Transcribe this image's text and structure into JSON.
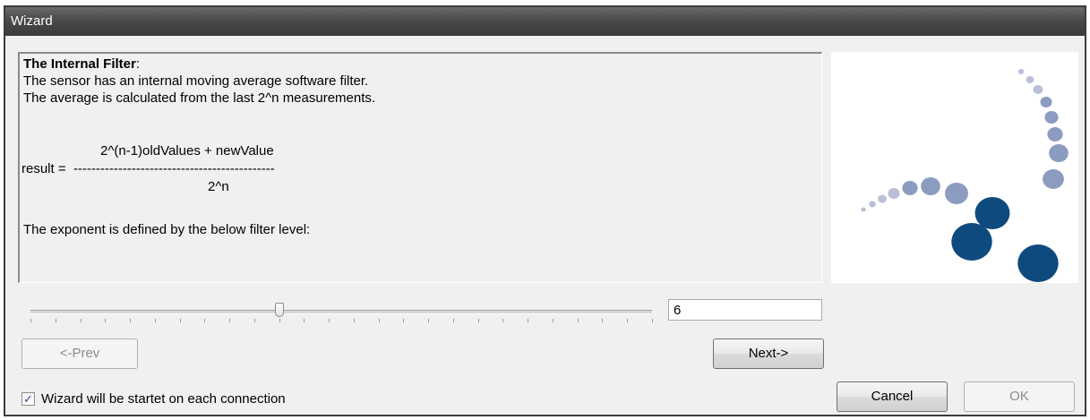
{
  "window": {
    "title": "Wizard"
  },
  "content": {
    "heading": "The Internal Filter",
    "heading_suffix": ":",
    "line1": "The sensor has an internal moving average software filter.",
    "line2": "The average is calculated from the last 2^n measurements.",
    "formula_numerator": "2^(n-1)oldValues + newValue",
    "formula_result": "result =  ---------------------------------------------",
    "formula_denominator": "2^n",
    "line3": "The exponent is defined by the below filter level:"
  },
  "filter": {
    "slider_value_fraction": 0.4,
    "value": "6"
  },
  "buttons": {
    "prev": "<-Prev",
    "next": "Next->",
    "cancel": "Cancel",
    "ok": "OK"
  },
  "checkbox": {
    "label": "Wizard will be startet on each connection",
    "checked": true,
    "check_mark": "✓"
  },
  "colors": {
    "logo_light": "#b8bfd6",
    "logo_mid": "#8c9cc0",
    "logo_dark": "#0f4a7e"
  }
}
